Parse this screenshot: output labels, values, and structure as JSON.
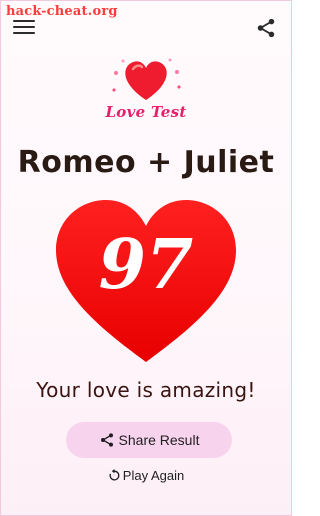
{
  "watermark": "hack-cheat.org",
  "header": {
    "menu_icon": "hamburger-menu-icon",
    "share_icon": "share-icon"
  },
  "logo": {
    "text": "Love Test",
    "icon": "heart-logo-icon"
  },
  "result": {
    "names": "Romeo + Juliet",
    "score": "97",
    "message": "Your love is amazing!"
  },
  "actions": {
    "share_label": "Share Result",
    "play_again_label": "Play Again"
  },
  "colors": {
    "heart_red": "#f00a0a",
    "logo_text": "#e8206a",
    "share_button_bg": "#f8d3ee",
    "background": "#fff7fb"
  }
}
